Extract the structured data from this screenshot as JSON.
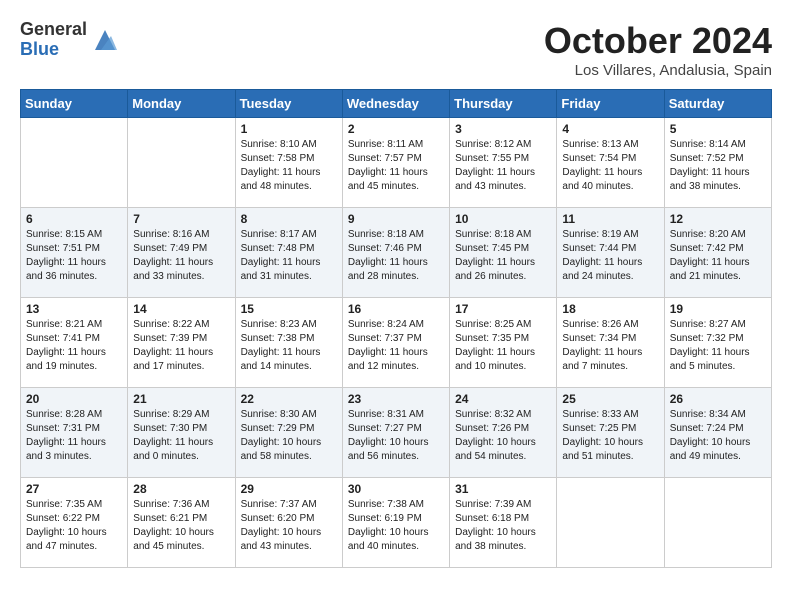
{
  "logo": {
    "general": "General",
    "blue": "Blue"
  },
  "title": "October 2024",
  "location": "Los Villares, Andalusia, Spain",
  "headers": [
    "Sunday",
    "Monday",
    "Tuesday",
    "Wednesday",
    "Thursday",
    "Friday",
    "Saturday"
  ],
  "weeks": [
    [
      {
        "day": "",
        "info": ""
      },
      {
        "day": "",
        "info": ""
      },
      {
        "day": "1",
        "info": "Sunrise: 8:10 AM\nSunset: 7:58 PM\nDaylight: 11 hours and 48 minutes."
      },
      {
        "day": "2",
        "info": "Sunrise: 8:11 AM\nSunset: 7:57 PM\nDaylight: 11 hours and 45 minutes."
      },
      {
        "day": "3",
        "info": "Sunrise: 8:12 AM\nSunset: 7:55 PM\nDaylight: 11 hours and 43 minutes."
      },
      {
        "day": "4",
        "info": "Sunrise: 8:13 AM\nSunset: 7:54 PM\nDaylight: 11 hours and 40 minutes."
      },
      {
        "day": "5",
        "info": "Sunrise: 8:14 AM\nSunset: 7:52 PM\nDaylight: 11 hours and 38 minutes."
      }
    ],
    [
      {
        "day": "6",
        "info": "Sunrise: 8:15 AM\nSunset: 7:51 PM\nDaylight: 11 hours and 36 minutes."
      },
      {
        "day": "7",
        "info": "Sunrise: 8:16 AM\nSunset: 7:49 PM\nDaylight: 11 hours and 33 minutes."
      },
      {
        "day": "8",
        "info": "Sunrise: 8:17 AM\nSunset: 7:48 PM\nDaylight: 11 hours and 31 minutes."
      },
      {
        "day": "9",
        "info": "Sunrise: 8:18 AM\nSunset: 7:46 PM\nDaylight: 11 hours and 28 minutes."
      },
      {
        "day": "10",
        "info": "Sunrise: 8:18 AM\nSunset: 7:45 PM\nDaylight: 11 hours and 26 minutes."
      },
      {
        "day": "11",
        "info": "Sunrise: 8:19 AM\nSunset: 7:44 PM\nDaylight: 11 hours and 24 minutes."
      },
      {
        "day": "12",
        "info": "Sunrise: 8:20 AM\nSunset: 7:42 PM\nDaylight: 11 hours and 21 minutes."
      }
    ],
    [
      {
        "day": "13",
        "info": "Sunrise: 8:21 AM\nSunset: 7:41 PM\nDaylight: 11 hours and 19 minutes."
      },
      {
        "day": "14",
        "info": "Sunrise: 8:22 AM\nSunset: 7:39 PM\nDaylight: 11 hours and 17 minutes."
      },
      {
        "day": "15",
        "info": "Sunrise: 8:23 AM\nSunset: 7:38 PM\nDaylight: 11 hours and 14 minutes."
      },
      {
        "day": "16",
        "info": "Sunrise: 8:24 AM\nSunset: 7:37 PM\nDaylight: 11 hours and 12 minutes."
      },
      {
        "day": "17",
        "info": "Sunrise: 8:25 AM\nSunset: 7:35 PM\nDaylight: 11 hours and 10 minutes."
      },
      {
        "day": "18",
        "info": "Sunrise: 8:26 AM\nSunset: 7:34 PM\nDaylight: 11 hours and 7 minutes."
      },
      {
        "day": "19",
        "info": "Sunrise: 8:27 AM\nSunset: 7:32 PM\nDaylight: 11 hours and 5 minutes."
      }
    ],
    [
      {
        "day": "20",
        "info": "Sunrise: 8:28 AM\nSunset: 7:31 PM\nDaylight: 11 hours and 3 minutes."
      },
      {
        "day": "21",
        "info": "Sunrise: 8:29 AM\nSunset: 7:30 PM\nDaylight: 11 hours and 0 minutes."
      },
      {
        "day": "22",
        "info": "Sunrise: 8:30 AM\nSunset: 7:29 PM\nDaylight: 10 hours and 58 minutes."
      },
      {
        "day": "23",
        "info": "Sunrise: 8:31 AM\nSunset: 7:27 PM\nDaylight: 10 hours and 56 minutes."
      },
      {
        "day": "24",
        "info": "Sunrise: 8:32 AM\nSunset: 7:26 PM\nDaylight: 10 hours and 54 minutes."
      },
      {
        "day": "25",
        "info": "Sunrise: 8:33 AM\nSunset: 7:25 PM\nDaylight: 10 hours and 51 minutes."
      },
      {
        "day": "26",
        "info": "Sunrise: 8:34 AM\nSunset: 7:24 PM\nDaylight: 10 hours and 49 minutes."
      }
    ],
    [
      {
        "day": "27",
        "info": "Sunrise: 7:35 AM\nSunset: 6:22 PM\nDaylight: 10 hours and 47 minutes."
      },
      {
        "day": "28",
        "info": "Sunrise: 7:36 AM\nSunset: 6:21 PM\nDaylight: 10 hours and 45 minutes."
      },
      {
        "day": "29",
        "info": "Sunrise: 7:37 AM\nSunset: 6:20 PM\nDaylight: 10 hours and 43 minutes."
      },
      {
        "day": "30",
        "info": "Sunrise: 7:38 AM\nSunset: 6:19 PM\nDaylight: 10 hours and 40 minutes."
      },
      {
        "day": "31",
        "info": "Sunrise: 7:39 AM\nSunset: 6:18 PM\nDaylight: 10 hours and 38 minutes."
      },
      {
        "day": "",
        "info": ""
      },
      {
        "day": "",
        "info": ""
      }
    ]
  ]
}
